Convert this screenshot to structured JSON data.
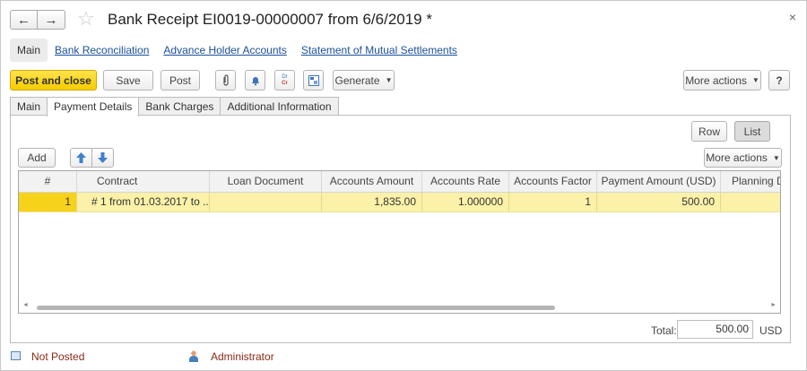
{
  "window": {
    "title": "Bank Receipt EI0019-00000007 from 6/6/2019 *",
    "close_glyph": "×"
  },
  "nav": {
    "back_glyph": "←",
    "forward_glyph": "→",
    "star_glyph": "☆"
  },
  "sections": [
    {
      "label": "Main",
      "active": true
    },
    {
      "label": "Bank Reconciliation",
      "active": false
    },
    {
      "label": "Advance Holder Accounts",
      "active": false
    },
    {
      "label": "Statement of Mutual Settlements",
      "active": false
    }
  ],
  "toolbar": {
    "post_and_close": "Post and close",
    "save": "Save",
    "post": "Post",
    "generate": "Generate",
    "more_actions": "More actions",
    "help": "?",
    "dr": "Dr",
    "cr": "Cr",
    "icons": [
      "paperclip-icon",
      "bell-icon",
      "dr-cr-icon",
      "report-icon"
    ]
  },
  "tabs": [
    {
      "label": "Main",
      "active": false
    },
    {
      "label": "Payment Details",
      "active": true
    },
    {
      "label": "Bank Charges",
      "active": false
    },
    {
      "label": "Additional Information",
      "active": false
    }
  ],
  "panel": {
    "view_row": "Row",
    "view_list": "List",
    "add": "Add",
    "more_actions": "More actions",
    "up_glyph": "🡅",
    "down_glyph": "🡇"
  },
  "grid": {
    "columns": [
      "#",
      "Contract",
      "Loan Document",
      "Accounts Amount",
      "Accounts Rate",
      "Accounts Factor",
      "Payment Amount (USD)",
      "Planning Do"
    ],
    "rows": [
      [
        "1",
        "# 1 from 01.03.2017 to ...",
        "",
        "1,835.00",
        "1.000000",
        "1",
        "500.00",
        ""
      ]
    ]
  },
  "total": {
    "label": "Total:",
    "value": "500.00",
    "currency": "USD"
  },
  "status": {
    "posting": "Not Posted",
    "user": "Administrator"
  },
  "colors": {
    "primary_button": "#f5cc00",
    "selected_row": "#fbf1a8",
    "link": "#1a4f9c",
    "status_text": "#8a2a16"
  }
}
